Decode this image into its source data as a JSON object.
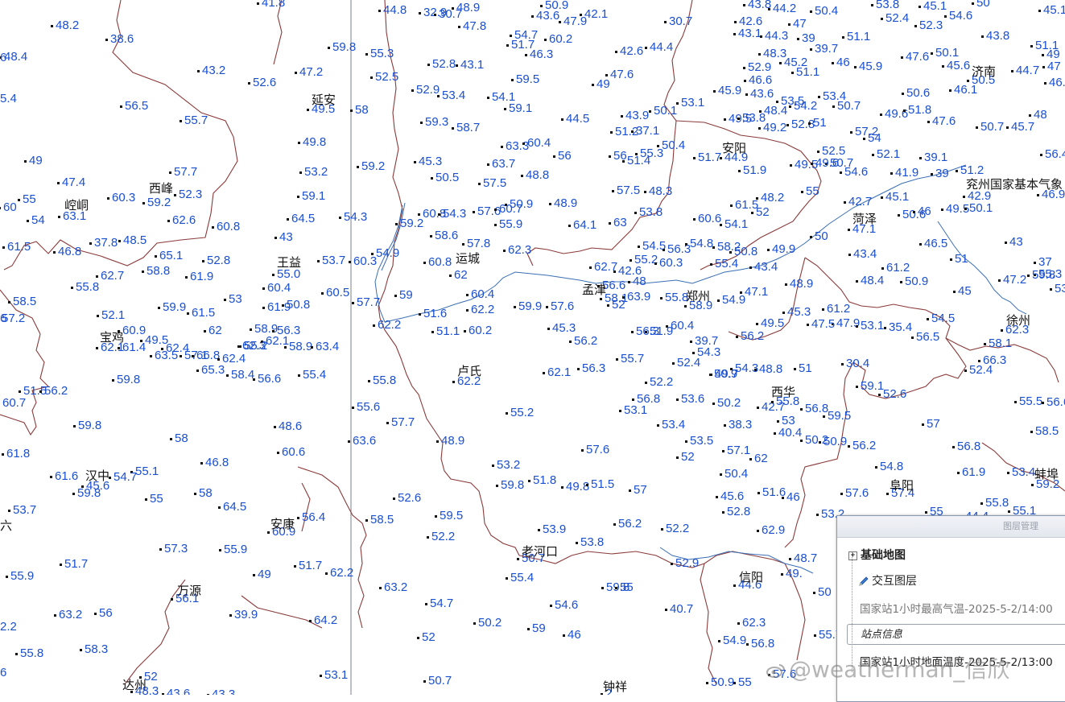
{
  "values": [
    {
      "t": "41.8"
    },
    {
      "t": "44.8"
    },
    {
      "t": "32.9"
    },
    {
      "t": "30.7"
    },
    {
      "t": "48.9"
    },
    {
      "t": "50.9"
    },
    {
      "t": "43.6"
    },
    {
      "t": "47.9"
    },
    {
      "t": "42.1"
    },
    {
      "t": "30.7"
    },
    {
      "t": "42.6"
    },
    {
      "t": "43.8"
    },
    {
      "t": "44.2"
    },
    {
      "t": "50.4"
    },
    {
      "t": "53.8"
    },
    {
      "t": "45.1"
    },
    {
      "t": "50"
    },
    {
      "t": "45.1"
    },
    {
      "t": "48.2"
    },
    {
      "t": "38.6"
    },
    {
      "t": "47.8"
    },
    {
      "t": "54.7"
    },
    {
      "t": "51.7"
    },
    {
      "t": "60.2"
    },
    {
      "t": "42.6"
    },
    {
      "t": "44.4"
    },
    {
      "t": "43.1"
    },
    {
      "t": "44.3"
    },
    {
      "t": "47"
    },
    {
      "t": "39"
    },
    {
      "t": "51.1"
    },
    {
      "t": "52.4"
    },
    {
      "t": "52.3"
    },
    {
      "t": "54.6"
    },
    {
      "t": "43.8"
    },
    {
      "t": "51.1"
    },
    {
      "t": "48.4"
    },
    {
      "t": "59.8"
    },
    {
      "t": "55.3"
    },
    {
      "t": "46.3"
    },
    {
      "t": "48.3"
    },
    {
      "t": "39.7"
    },
    {
      "t": "47.6"
    },
    {
      "t": "50.1"
    },
    {
      "t": "49"
    },
    {
      "t": "43.2"
    },
    {
      "t": "47.2"
    },
    {
      "t": "52.8"
    },
    {
      "t": "43.1"
    },
    {
      "t": "52.9"
    },
    {
      "t": "45.2"
    },
    {
      "t": "51.1"
    },
    {
      "t": "46"
    },
    {
      "t": "45.9"
    },
    {
      "t": "45.6"
    },
    {
      "t": "50.5"
    },
    {
      "t": "44.7"
    },
    {
      "t": "47"
    },
    {
      "t": "52.6"
    },
    {
      "t": "52.5"
    },
    {
      "t": "59.5"
    },
    {
      "t": "49"
    },
    {
      "t": "47.6"
    },
    {
      "t": "46.6"
    },
    {
      "t": "46.2"
    },
    {
      "t": "52.9"
    },
    {
      "t": "53.4"
    },
    {
      "t": "54.1"
    },
    {
      "t": "45.9"
    },
    {
      "t": "43.6"
    },
    {
      "t": "53.4"
    },
    {
      "t": "50.6"
    },
    {
      "t": "46.1"
    },
    {
      "t": "56.5"
    },
    {
      "t": "49.5"
    },
    {
      "t": "58"
    },
    {
      "t": "59.1"
    },
    {
      "t": "53.1"
    },
    {
      "t": "53.5"
    },
    {
      "t": "54.2"
    },
    {
      "t": "50.7"
    },
    {
      "t": "49.6"
    },
    {
      "t": "51.8"
    },
    {
      "t": "48"
    },
    {
      "t": "55.7"
    },
    {
      "t": "59.3"
    },
    {
      "t": "58.7"
    },
    {
      "t": "44.5"
    },
    {
      "t": "43.9"
    },
    {
      "t": "50.1"
    },
    {
      "t": "49.5"
    },
    {
      "t": "48.4"
    },
    {
      "t": "53.8"
    },
    {
      "t": "49.2"
    },
    {
      "t": "52.8"
    },
    {
      "t": "51"
    },
    {
      "t": "47.6"
    },
    {
      "t": "50.7"
    },
    {
      "t": "45.7"
    },
    {
      "t": "51.2"
    },
    {
      "t": "37.1"
    },
    {
      "t": "57.2"
    },
    {
      "t": "49.8"
    },
    {
      "t": "63.3"
    },
    {
      "t": "60.4"
    },
    {
      "t": "54"
    },
    {
      "t": "50.4"
    },
    {
      "t": "49"
    },
    {
      "t": "53.2"
    },
    {
      "t": "59.2"
    },
    {
      "t": "45.3"
    },
    {
      "t": "63.7"
    },
    {
      "t": "56"
    },
    {
      "t": "56"
    },
    {
      "t": "51.4"
    },
    {
      "t": "55.3"
    },
    {
      "t": "51.7"
    },
    {
      "t": "44.9"
    },
    {
      "t": "52.5"
    },
    {
      "t": "50.7"
    },
    {
      "t": "52.1"
    },
    {
      "t": "39.1"
    },
    {
      "t": "56.4"
    },
    {
      "t": "47.4"
    },
    {
      "t": "50.5"
    },
    {
      "t": "48.8"
    },
    {
      "t": "51.9"
    },
    {
      "t": "49.5"
    },
    {
      "t": "49.6"
    },
    {
      "t": "54.6"
    },
    {
      "t": "41.9"
    },
    {
      "t": "39"
    },
    {
      "t": "51.2"
    },
    {
      "t": "57.7"
    },
    {
      "t": "57.5"
    },
    {
      "t": "57.5"
    },
    {
      "t": "48.3"
    },
    {
      "t": "55"
    },
    {
      "t": "52.3"
    },
    {
      "t": "60.3"
    },
    {
      "t": "59.2"
    },
    {
      "t": "59.1"
    },
    {
      "t": "48.9"
    },
    {
      "t": "48.2"
    },
    {
      "t": "42.7"
    },
    {
      "t": "45.1"
    },
    {
      "t": "42.9"
    },
    {
      "t": "46.9"
    },
    {
      "t": "55"
    },
    {
      "t": "60"
    },
    {
      "t": "50.9"
    },
    {
      "t": "61.5"
    },
    {
      "t": "63.1"
    },
    {
      "t": "62.6"
    },
    {
      "t": "60.8"
    },
    {
      "t": "54.3"
    },
    {
      "t": "57.6"
    },
    {
      "t": "60.7"
    },
    {
      "t": "53.8"
    },
    {
      "t": "52"
    },
    {
      "t": "50.6"
    },
    {
      "t": "46"
    },
    {
      "t": "49.5"
    },
    {
      "t": "50.1"
    },
    {
      "t": "54"
    },
    {
      "t": "64.5"
    },
    {
      "t": "54.3"
    },
    {
      "t": "59.2"
    },
    {
      "t": "55.9"
    },
    {
      "t": "64.1"
    },
    {
      "t": "63"
    },
    {
      "t": "60.6"
    },
    {
      "t": "54.1"
    },
    {
      "t": "37.8"
    },
    {
      "t": "60.8"
    },
    {
      "t": "47.1"
    },
    {
      "t": "61.5"
    },
    {
      "t": "48.5"
    },
    {
      "t": "43"
    },
    {
      "t": "58.6"
    },
    {
      "t": "50"
    },
    {
      "t": "46.5"
    },
    {
      "t": "43"
    },
    {
      "t": "46.8"
    },
    {
      "t": "65.1"
    },
    {
      "t": "57.8"
    },
    {
      "t": "54.5"
    },
    {
      "t": "56.3"
    },
    {
      "t": "54.8"
    },
    {
      "t": "58.2"
    },
    {
      "t": "49.9"
    },
    {
      "t": "54.9"
    },
    {
      "t": "62.3"
    },
    {
      "t": "50.8"
    },
    {
      "t": "43.4"
    },
    {
      "t": "51"
    },
    {
      "t": "37"
    },
    {
      "t": "58.8"
    },
    {
      "t": "52.8"
    },
    {
      "t": "60.3"
    },
    {
      "t": "53.7"
    },
    {
      "t": "60.8"
    },
    {
      "t": "55.2"
    },
    {
      "t": "60.3"
    },
    {
      "t": "55.4"
    },
    {
      "t": "43.4"
    },
    {
      "t": "61.2"
    },
    {
      "t": "62.7"
    },
    {
      "t": "61.9"
    },
    {
      "t": "55.0"
    },
    {
      "t": "62"
    },
    {
      "t": "62.7"
    },
    {
      "t": "42.6"
    },
    {
      "t": "55.3"
    },
    {
      "t": "55.8"
    },
    {
      "t": "60.4"
    },
    {
      "t": "56.6"
    },
    {
      "t": "48"
    },
    {
      "t": "48.9"
    },
    {
      "t": "48.4"
    },
    {
      "t": "50.9"
    },
    {
      "t": "47.2"
    },
    {
      "t": "59.8"
    },
    {
      "t": "60.5"
    },
    {
      "t": "59"
    },
    {
      "t": "60.4"
    },
    {
      "t": "58.1"
    },
    {
      "t": "63.9"
    },
    {
      "t": "55.8"
    },
    {
      "t": "58.9"
    },
    {
      "t": "47.1"
    },
    {
      "t": "45"
    },
    {
      "t": "53.8"
    },
    {
      "t": "58.5"
    },
    {
      "t": "53"
    },
    {
      "t": "61.9"
    },
    {
      "t": "50.8"
    },
    {
      "t": "57.7"
    },
    {
      "t": "62.2"
    },
    {
      "t": "59.9"
    },
    {
      "t": "57.6"
    },
    {
      "t": "52"
    },
    {
      "t": "54.9"
    },
    {
      "t": "61.2"
    },
    {
      "t": "52.1"
    },
    {
      "t": "59.9"
    },
    {
      "t": "61.5"
    },
    {
      "t": "51.6"
    },
    {
      "t": "45.3"
    },
    {
      "t": "47.9"
    },
    {
      "t": "54.5"
    },
    {
      "t": "57.2"
    },
    {
      "t": "62.2"
    },
    {
      "t": "51.1"
    },
    {
      "t": "49.5"
    },
    {
      "t": "47.5"
    },
    {
      "t": "53.1"
    },
    {
      "t": "35.4"
    },
    {
      "t": "62.3"
    },
    {
      "t": "60.9"
    },
    {
      "t": "49.5"
    },
    {
      "t": "62"
    },
    {
      "t": "58.9"
    },
    {
      "t": "56.3"
    },
    {
      "t": "60.2"
    },
    {
      "t": "60.4"
    },
    {
      "t": "45.3"
    },
    {
      "t": "56.3"
    },
    {
      "t": "51.9"
    },
    {
      "t": "56.2"
    },
    {
      "t": "56.5"
    },
    {
      "t": "62.1"
    },
    {
      "t": "61.4"
    },
    {
      "t": "62.4"
    },
    {
      "t": "62.3"
    },
    {
      "t": "62.1"
    },
    {
      "t": "58.9"
    },
    {
      "t": "63.4"
    },
    {
      "t": "56.2"
    },
    {
      "t": "39.7"
    },
    {
      "t": "58.1"
    },
    {
      "t": "63.5"
    },
    {
      "t": "57.1"
    },
    {
      "t": "66.8"
    },
    {
      "t": "62.4"
    },
    {
      "t": "55.2"
    },
    {
      "t": "54.3"
    },
    {
      "t": "66.3"
    },
    {
      "t": "65.3"
    },
    {
      "t": "58.4"
    },
    {
      "t": "55.7"
    },
    {
      "t": "52.4"
    },
    {
      "t": "49.7"
    },
    {
      "t": "59.8"
    },
    {
      "t": "56.6"
    },
    {
      "t": "55.4"
    },
    {
      "t": "55.8"
    },
    {
      "t": "62.2"
    },
    {
      "t": "62.1"
    },
    {
      "t": "56.3"
    },
    {
      "t": "52.2"
    },
    {
      "t": "50.9"
    },
    {
      "t": "54.3"
    },
    {
      "t": "48.8"
    },
    {
      "t": "51"
    },
    {
      "t": "52.4"
    },
    {
      "t": "30.4"
    },
    {
      "t": "51.5"
    },
    {
      "t": "56.2"
    },
    {
      "t": "59.1"
    },
    {
      "t": "52.6"
    },
    {
      "t": "60.7"
    },
    {
      "t": "56.8"
    },
    {
      "t": "53.6"
    },
    {
      "t": "50.2"
    },
    {
      "t": "42.7"
    },
    {
      "t": "55.8"
    },
    {
      "t": "56.8"
    },
    {
      "t": "55.5"
    },
    {
      "t": "56.6"
    },
    {
      "t": "55.6"
    },
    {
      "t": "57.7"
    },
    {
      "t": "55.2"
    },
    {
      "t": "53.1"
    },
    {
      "t": "53.4"
    },
    {
      "t": "38.3"
    },
    {
      "t": "53"
    },
    {
      "t": "59.5"
    },
    {
      "t": "57"
    },
    {
      "t": "58.5"
    },
    {
      "t": "59.8"
    },
    {
      "t": "48.6"
    },
    {
      "t": "40.4"
    },
    {
      "t": "50.2"
    },
    {
      "t": "50.9"
    },
    {
      "t": "56.2"
    },
    {
      "t": "56.8"
    },
    {
      "t": "58"
    },
    {
      "t": "63.6"
    },
    {
      "t": "48.9"
    },
    {
      "t": "57.6"
    },
    {
      "t": "53.5"
    },
    {
      "t": "57.1"
    },
    {
      "t": "62"
    },
    {
      "t": "61.8"
    },
    {
      "t": "60.6"
    },
    {
      "t": "46.8"
    },
    {
      "t": "52"
    },
    {
      "t": "61.9"
    },
    {
      "t": "53.2"
    },
    {
      "t": "50.4"
    },
    {
      "t": "54.8"
    },
    {
      "t": "53.4"
    },
    {
      "t": "61.6"
    },
    {
      "t": "55.1"
    },
    {
      "t": "54.7"
    },
    {
      "t": "59.8"
    },
    {
      "t": "51.8"
    },
    {
      "t": "49.8"
    },
    {
      "t": "51.5"
    },
    {
      "t": "57"
    },
    {
      "t": "45.6"
    },
    {
      "t": "51.6"
    },
    {
      "t": "46"
    },
    {
      "t": "57.6"
    },
    {
      "t": "57.4"
    },
    {
      "t": "59.2"
    },
    {
      "t": "59.8"
    },
    {
      "t": "45.6"
    },
    {
      "t": "55"
    },
    {
      "t": "58"
    },
    {
      "t": "52.6"
    },
    {
      "t": "52.8"
    },
    {
      "t": "53.2"
    },
    {
      "t": "44.4"
    },
    {
      "t": "55"
    },
    {
      "t": "55.8"
    },
    {
      "t": "55.1"
    },
    {
      "t": "53.7"
    },
    {
      "t": "64.5"
    },
    {
      "t": "59.5"
    },
    {
      "t": "56.4"
    },
    {
      "t": "58.5"
    },
    {
      "t": "53.9"
    },
    {
      "t": "56.2"
    },
    {
      "t": "52.2"
    },
    {
      "t": "62.9"
    },
    {
      "t": "60.9"
    },
    {
      "t": "52.2"
    },
    {
      "t": "53.8"
    },
    {
      "t": "57.3"
    },
    {
      "t": "55.9"
    },
    {
      "t": "63.2"
    },
    {
      "t": "50.7"
    },
    {
      "t": "52.9"
    },
    {
      "t": "48.7"
    },
    {
      "t": "51.7"
    },
    {
      "t": "62.2"
    },
    {
      "t": "55.4"
    },
    {
      "t": "44.6"
    },
    {
      "t": "49."
    },
    {
      "t": "50"
    },
    {
      "t": "51.7"
    },
    {
      "t": "49"
    },
    {
      "t": "55.9"
    },
    {
      "t": "59.8"
    },
    {
      "t": "55"
    },
    {
      "t": "56.1"
    },
    {
      "t": "54.7"
    },
    {
      "t": "54.6"
    },
    {
      "t": "40.7"
    },
    {
      "t": "63.2"
    },
    {
      "t": "56"
    },
    {
      "t": "39.9"
    },
    {
      "t": "64.2"
    },
    {
      "t": "50.2"
    },
    {
      "t": "62.3"
    },
    {
      "t": "59"
    },
    {
      "t": "46"
    },
    {
      "t": "55.7"
    },
    {
      "t": "55.8"
    },
    {
      "t": "58.3"
    },
    {
      "t": "52"
    },
    {
      "t": "50.7"
    },
    {
      "t": "54.9"
    },
    {
      "t": "56.8"
    },
    {
      "t": "53.1"
    },
    {
      "t": "57.6"
    },
    {
      "t": "52"
    },
    {
      "t": "43.6"
    },
    {
      "t": "50.9"
    },
    {
      "t": "55"
    },
    {
      "t": "48.3"
    },
    {
      "t": "43.3"
    },
    {
      "t": "2"
    },
    {
      "t": "2.2"
    },
    {
      "t": "6"
    },
    {
      "t": "6"
    },
    {
      "t": "5.4"
    },
    {
      "t": "6"
    }
  ],
  "cities": [
    {
      "t": "延安"
    },
    {
      "t": "济南"
    },
    {
      "t": "西峰"
    },
    {
      "t": "安阳"
    },
    {
      "t": "崆峒"
    },
    {
      "t": "兖州国家基本气象"
    },
    {
      "t": "菏泽"
    },
    {
      "t": "王益"
    },
    {
      "t": "运城"
    },
    {
      "t": "孟津"
    },
    {
      "t": "郑州"
    },
    {
      "t": "徐州"
    },
    {
      "t": "宝鸡"
    },
    {
      "t": "卢氏"
    },
    {
      "t": "西华"
    },
    {
      "t": "汉中"
    },
    {
      "t": "阜阳"
    },
    {
      "t": "蚌埠"
    },
    {
      "t": "安康"
    },
    {
      "t": "老河口"
    },
    {
      "t": "信阳"
    },
    {
      "t": "万源"
    },
    {
      "t": "达州"
    },
    {
      "t": "钟祥"
    },
    {
      "t": "六"
    }
  ],
  "panel": {
    "title": "图层管理",
    "base_map": "基础地图",
    "interactive_layer": "交互图层",
    "layer1": "国家站1小时最高气温-2025-5-2/14:00",
    "station_info": "站点信息",
    "layer2": "国家站1小时地面温度-2025-5-2/13:00"
  },
  "watermark": "@weatherman_信欣",
  "colors": {
    "value": "#1a4fd0",
    "border": "#8b3a3a",
    "river": "#3b6fb5",
    "divider": "#7a7f8c"
  }
}
